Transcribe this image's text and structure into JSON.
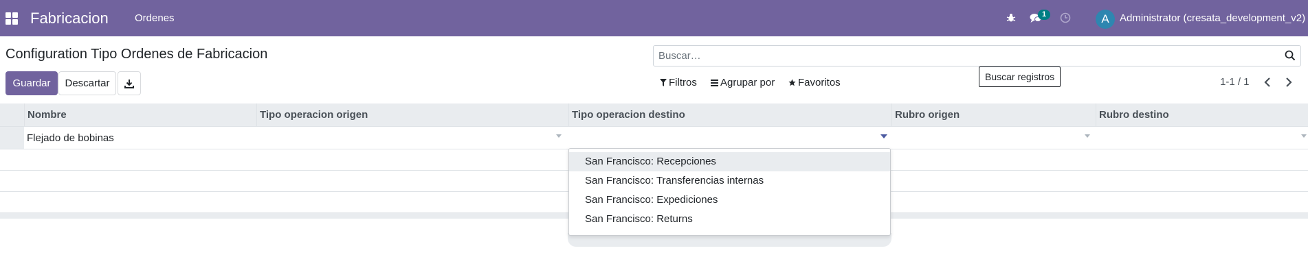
{
  "navbar": {
    "app_name": "Fabricacion",
    "menu": [
      "Ordenes"
    ],
    "messages_badge": "1",
    "avatar_letter": "A",
    "user": "Administrator (cresata_development_v2)",
    "color": "#71639e"
  },
  "control_panel": {
    "title": "Configuration Tipo Ordenes de Fabricacion",
    "save_label": "Guardar",
    "discard_label": "Descartar",
    "search_placeholder": "Buscar…",
    "search_tooltip": "Buscar registros",
    "filters_label": "Filtros",
    "group_by_label": "Agrupar por",
    "favorites_label": "Favoritos",
    "pager": "1-1 / 1"
  },
  "table": {
    "columns": [
      "Nombre",
      "Tipo operacion origen",
      "Tipo operacion destino",
      "Rubro origen",
      "Rubro destino"
    ],
    "rows": [
      {
        "nombre": "Flejado de bobinas",
        "tipo_origen": "",
        "tipo_destino": "",
        "rubro_origen": "",
        "rubro_destino": ""
      }
    ]
  },
  "dropdown": {
    "options": [
      "San Francisco: Recepciones",
      "San Francisco: Transferencias internas",
      "San Francisco: Expediciones",
      "San Francisco: Returns"
    ]
  },
  "icons": {
    "apps": "apps-grid-icon",
    "bug": "bug-icon",
    "messages": "chat-icon",
    "activity": "clock-icon",
    "download": "download-icon",
    "search": "search-icon",
    "filter": "filter-icon",
    "group": "list-icon",
    "favorite": "star-icon"
  }
}
